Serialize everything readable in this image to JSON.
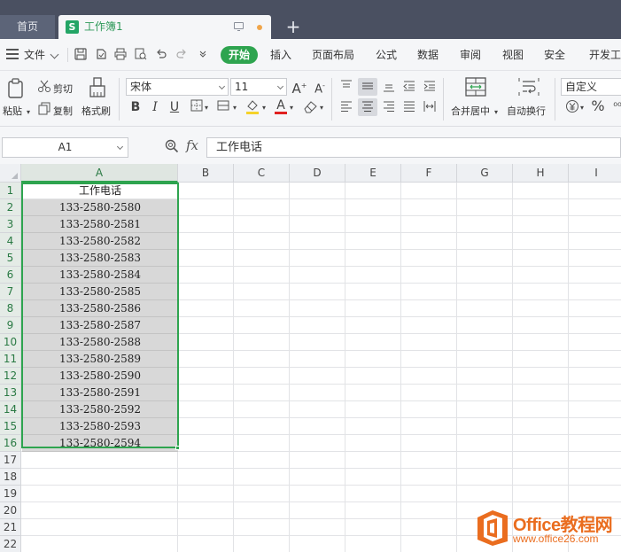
{
  "tabs": {
    "home": "首页",
    "doc": "工作簿1",
    "add": "+"
  },
  "menu": {
    "file": "文件",
    "start": "开始",
    "items": [
      "插入",
      "页面布局",
      "公式",
      "数据",
      "审阅",
      "视图",
      "安全",
      "开发工"
    ]
  },
  "toolbar": {
    "paste": "粘贴",
    "cut": "剪切",
    "copy": "复制",
    "format_painter": "格式刷",
    "font_name": "宋体",
    "font_size": "11",
    "merge_center": "合并居中",
    "wrap_text": "自动换行",
    "number_format": "自定义",
    "font_color": "#e02020",
    "fill_color": "#f5d22a",
    "accent": "#2ea44f"
  },
  "formula": {
    "cell_ref": "A1",
    "fx": "fx",
    "content": "工作电话"
  },
  "columns": [
    "A",
    "B",
    "C",
    "D",
    "E",
    "F",
    "G",
    "H",
    "I"
  ],
  "rows": [
    "1",
    "2",
    "3",
    "4",
    "5",
    "6",
    "7",
    "8",
    "9",
    "10",
    "11",
    "12",
    "13",
    "14",
    "15",
    "16",
    "17",
    "18",
    "19",
    "20",
    "21",
    "22"
  ],
  "cells": [
    "工作电话",
    "133-2580-2580",
    "133-2580-2581",
    "133-2580-2582",
    "133-2580-2583",
    "133-2580-2584",
    "133-2580-2585",
    "133-2580-2586",
    "133-2580-2587",
    "133-2580-2588",
    "133-2580-2589",
    "133-2580-2590",
    "133-2580-2591",
    "133-2580-2592",
    "133-2580-2593",
    "133-2580-2594"
  ],
  "watermark": {
    "title": "Office教程网",
    "url": "www.office26.com",
    "color": "#ea6d1f"
  }
}
